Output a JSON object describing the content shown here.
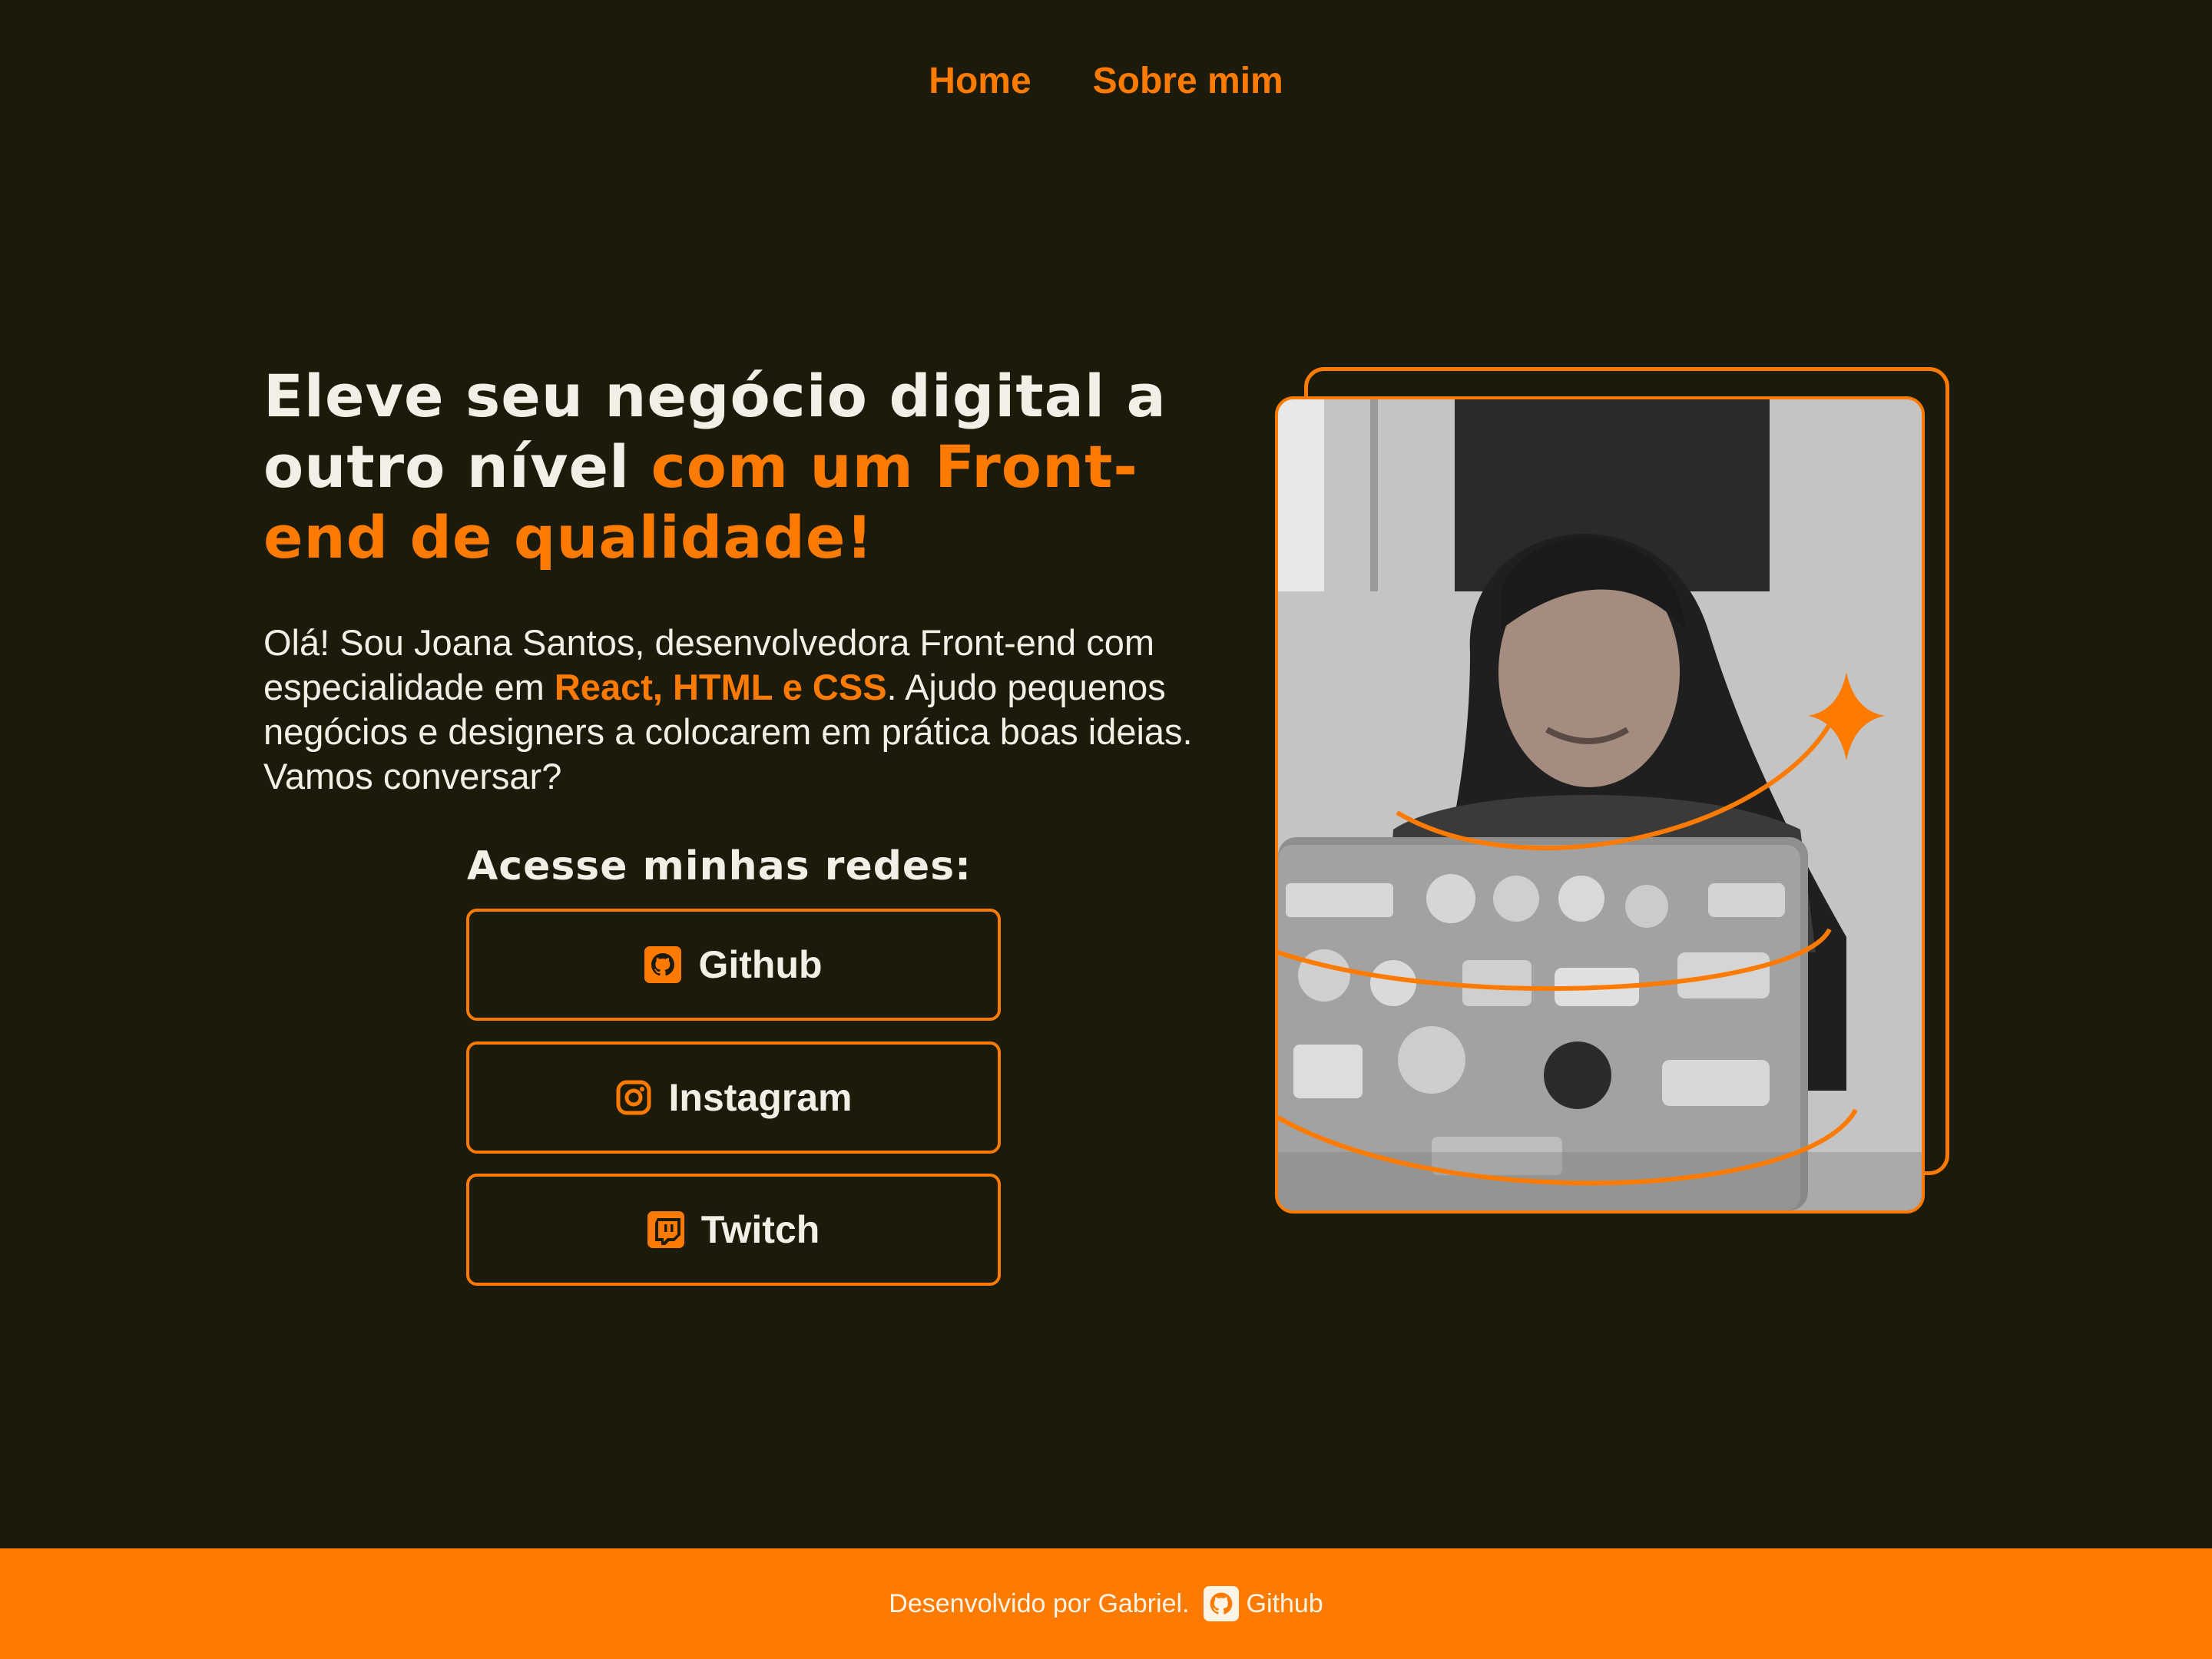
{
  "nav": {
    "items": [
      "Home",
      "Sobre mim"
    ]
  },
  "hero": {
    "title_part1": "Eleve seu negócio digital a outro nível ",
    "title_part2": "com um Front-end de qualidade!",
    "intro_before": "Olá! Sou Joana Santos, desenvolvedora Front-end com especialidade em ",
    "intro_strong": "React, HTML e CSS",
    "intro_after": ". Ajudo pequenos negócios e designers a colocarem em prática boas ideias. Vamos conversar?"
  },
  "social": {
    "heading": "Acesse minhas redes:",
    "links": [
      {
        "label": "Github",
        "icon": "github-icon"
      },
      {
        "label": "Instagram",
        "icon": "instagram-icon"
      },
      {
        "label": "Twitch",
        "icon": "twitch-icon"
      }
    ]
  },
  "photo": {
    "alt": "Joana Santos"
  },
  "footer": {
    "credit": "Desenvolvido por Gabriel.",
    "link_label": "Github",
    "icon": "github-icon"
  },
  "colors": {
    "background": "#1c1a08",
    "accent": "#ff7b00",
    "text": "#f2efe6"
  }
}
